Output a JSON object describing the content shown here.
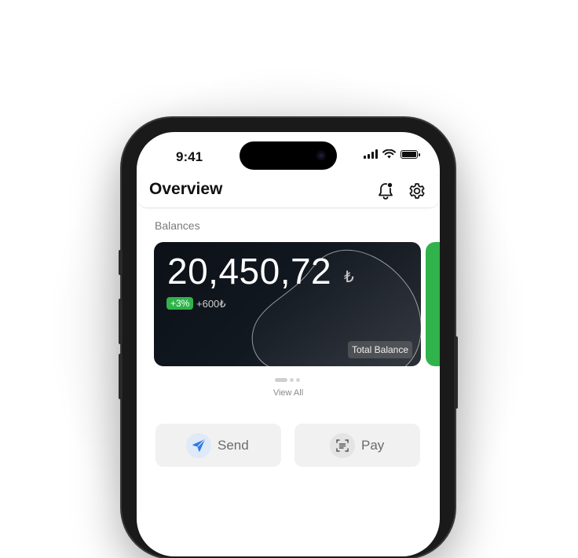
{
  "status_bar": {
    "time": "9:41"
  },
  "header": {
    "title": "Overview"
  },
  "balances": {
    "section_label": "Balances",
    "card": {
      "amount": "20,450,72",
      "currency": "₺",
      "change_percent": "+3%",
      "change_amount": "+600₺",
      "tag": "Total Balance"
    },
    "view_all": "View All"
  },
  "actions": {
    "send_label": "Send",
    "pay_label": "Pay"
  },
  "colors": {
    "accent_green": "#2fb34a",
    "send_icon_blue": "#2c7be5"
  }
}
